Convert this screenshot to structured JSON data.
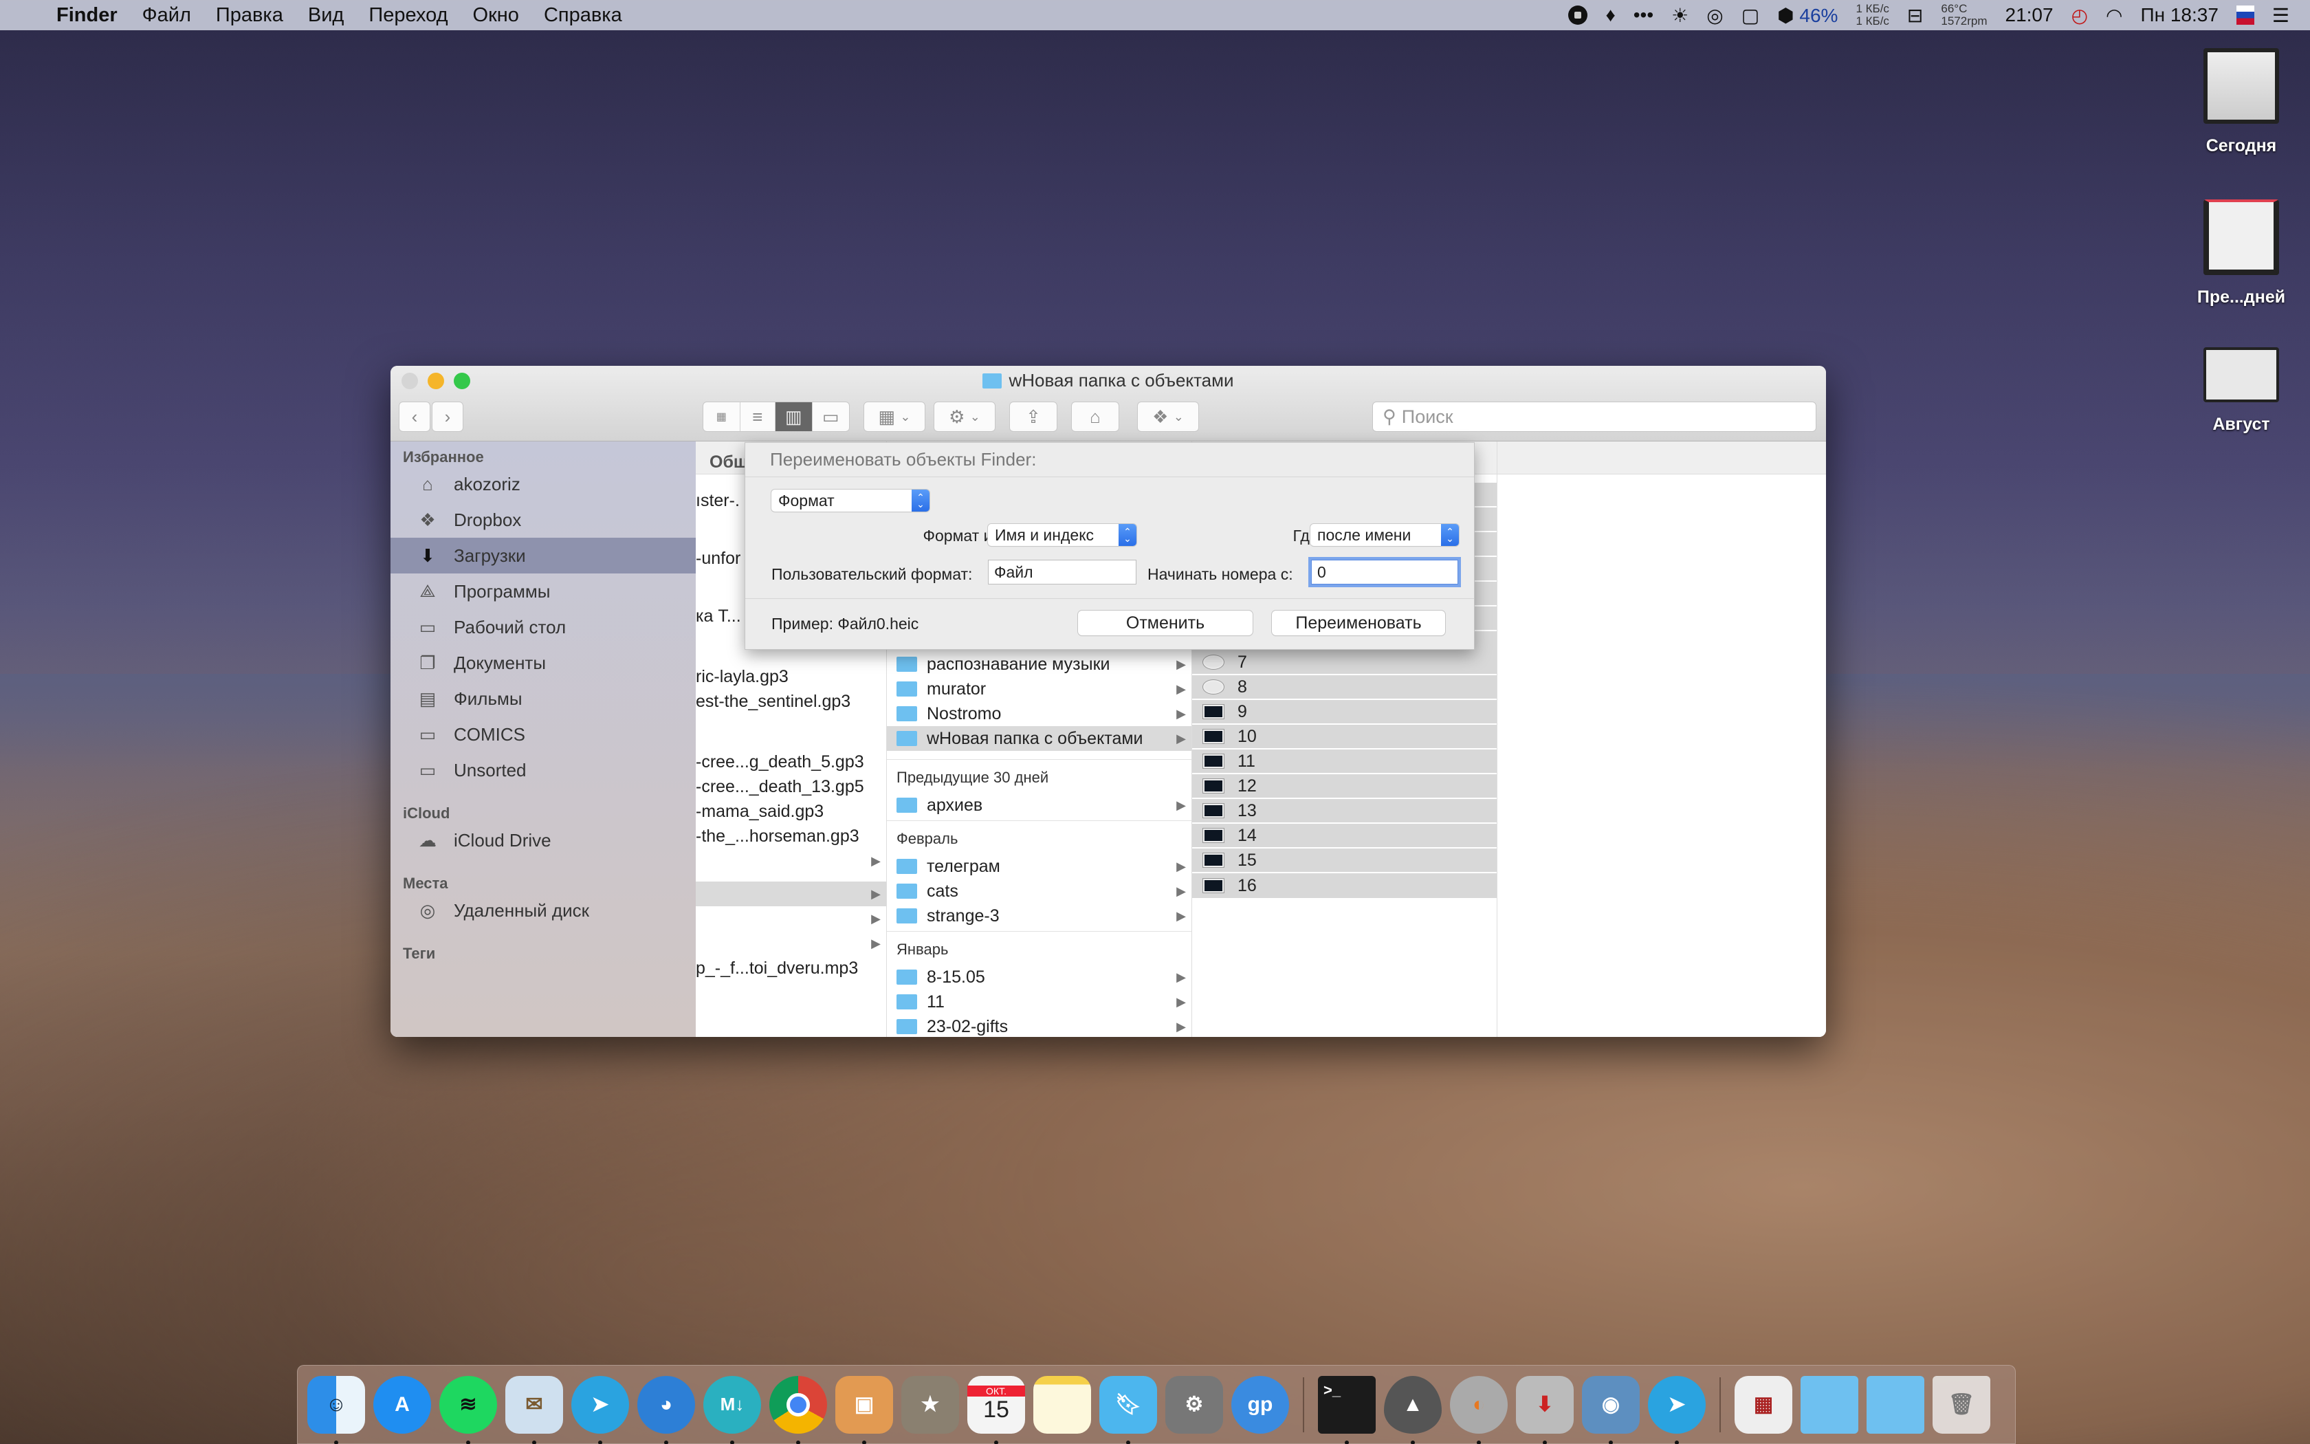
{
  "menubar": {
    "app_name": "Finder",
    "menus": [
      "Файл",
      "Правка",
      "Вид",
      "Переход",
      "Окно",
      "Справка"
    ],
    "battery_percent": "46%",
    "net_up": "1 КБ/с",
    "net_down": "1 КБ/с",
    "temp": "66°C",
    "fan": "1572rpm",
    "clock_time": "21:07",
    "day_time": "Пн 18:37",
    "icons": [
      "record-icon",
      "flame-icon",
      "more-dots-icon",
      "brightness-icon",
      "owl-icon",
      "display-icon",
      "shield-icon",
      "battery-icon",
      "timer-icon",
      "wifi-icon",
      "flag-ru-icon",
      "list-icon"
    ]
  },
  "desktop": {
    "stacks": [
      {
        "label": "Сегодня",
        "icon": "mov-file-icon"
      },
      {
        "label": "Пре...дней",
        "icon": "screenshot-stack-icon"
      },
      {
        "label": "Август",
        "icon": "photo-stack-icon"
      }
    ]
  },
  "window": {
    "title": "wНовая папка с объектами",
    "search_placeholder": "Поиск",
    "colors": {
      "close": "#d5d5d5",
      "minimize": "#f5b52a",
      "zoom": "#34c84a",
      "folder": "#6ec0f0",
      "selection": "#8e92ad"
    }
  },
  "sidebar": {
    "favorites_header": "Избранное",
    "favorites": [
      {
        "label": "akozoriz",
        "icon": "home-icon"
      },
      {
        "label": "Dropbox",
        "icon": "dropbox-icon"
      },
      {
        "label": "Загрузки",
        "icon": "downloads-icon",
        "selected": true
      },
      {
        "label": "Программы",
        "icon": "applications-icon"
      },
      {
        "label": "Рабочий стол",
        "icon": "desktop-icon"
      },
      {
        "label": "Документы",
        "icon": "documents-icon"
      },
      {
        "label": "Фильмы",
        "icon": "movies-icon"
      },
      {
        "label": "COMICS",
        "icon": "folder-icon"
      },
      {
        "label": "Unsorted",
        "icon": "folder-icon"
      }
    ],
    "icloud_header": "iCloud",
    "icloud": [
      {
        "label": "iCloud Drive",
        "icon": "cloud-icon"
      }
    ],
    "places_header": "Места",
    "places": [
      {
        "label": "Удаленный диск",
        "icon": "disc-icon"
      }
    ],
    "tags_header": "Теги"
  },
  "columns": {
    "col1_header": "Общ",
    "col1_items": [
      "ıster-.",
      "-unfor",
      "ка Т...",
      "ric-layla.gp3",
      "est-the_sentinel.gp3",
      "-cree...g_death_5.gp3",
      "-cree..._death_13.gp5",
      "-mama_said.gp3",
      "-the_...horseman.gp3",
      "p_-_f...toi_dveru.mp3"
    ],
    "col2_items_top": [
      "распознавание музыки",
      "murator",
      "Nostromo",
      "wНовая папка с объектами"
    ],
    "col2_group_prev30": "Предыдущие 30 дней",
    "col2_prev30": [
      "архиев"
    ],
    "col2_group_feb": "Февраль",
    "col2_feb": [
      "телеграм",
      "cats",
      "strange-3"
    ],
    "col2_group_jan": "Январь",
    "col2_jan": [
      "8-15.05",
      "11",
      "23-02-gifts"
    ],
    "col3_items": [
      "7",
      "8",
      "9",
      "10",
      "11",
      "12",
      "13",
      "14",
      "15",
      "16"
    ]
  },
  "rename_sheet": {
    "title": "Переименовать объекты Finder:",
    "mode_popup": "Формат",
    "name_format_label": "Формат имени:",
    "name_format_value": "Имя и индекс",
    "where_label": "Где:",
    "where_value": "после имени",
    "custom_format_label": "Пользовательский формат:",
    "custom_format_value": "Файл",
    "start_number_label": "Начинать номера с:",
    "start_number_value": "0",
    "example": "Пример: Файл0.heic",
    "cancel_label": "Отменить",
    "rename_label": "Переименовать"
  },
  "dock": {
    "apps": [
      {
        "name": "finder",
        "running": true,
        "color": "#3a8ee6"
      },
      {
        "name": "app-store",
        "running": false,
        "color": "#1f8ef1"
      },
      {
        "name": "spotify",
        "running": true,
        "color": "#1ed760"
      },
      {
        "name": "mail",
        "running": true,
        "color": "#7aa7d6"
      },
      {
        "name": "telegram",
        "running": true,
        "color": "#2aa3e0"
      },
      {
        "name": "tweetbot",
        "running": true,
        "color": "#2d7fd6"
      },
      {
        "name": "markdown",
        "running": true,
        "color": "#2ab0c0"
      },
      {
        "name": "chrome",
        "running": true,
        "color": "#e8b42a"
      },
      {
        "name": "pixelmator",
        "running": true,
        "color": "#e29a52"
      },
      {
        "name": "reeder",
        "running": false,
        "color": "#8a8070"
      },
      {
        "name": "calendar",
        "running": true,
        "color": "#f4f4f4"
      },
      {
        "name": "notes",
        "running": false,
        "color": "#fdf6c8"
      },
      {
        "name": "day-one",
        "running": true,
        "color": "#4cb6ee"
      },
      {
        "name": "system-preferences",
        "running": false,
        "color": "#777"
      },
      {
        "name": "guitar-pro",
        "running": false,
        "color": "#3a8be0"
      },
      {
        "name": "terminal",
        "running": true,
        "color": "#1b1b1b"
      },
      {
        "name": "alfred",
        "running": true,
        "color": "#555"
      },
      {
        "name": "cyberduck",
        "running": true,
        "color": "#aaa"
      },
      {
        "name": "transmission",
        "running": true,
        "color": "#bbb"
      },
      {
        "name": "preview",
        "running": true,
        "color": "#5d8fc0"
      },
      {
        "name": "telegram-desktop",
        "running": true,
        "color": "#2aa3e0"
      }
    ],
    "stacks": [
      "downloads-stack",
      "folder-stack",
      "documents-stack",
      "trash"
    ],
    "calendar_month": "ОКТ.",
    "calendar_day": "15"
  }
}
